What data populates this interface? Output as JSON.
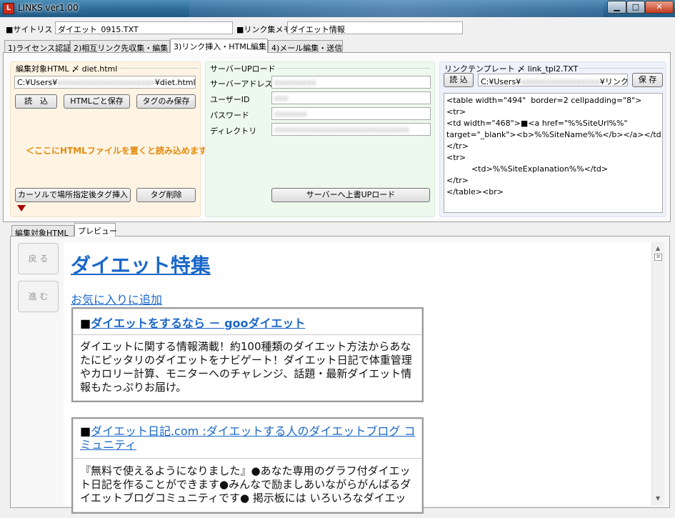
{
  "window": {
    "title": "LINKS ver1.00",
    "icon_letter": "L",
    "min_glyph": "▁",
    "max_glyph": "□",
    "close_glyph": "✕"
  },
  "top": {
    "site_list_label": "■サイトリスト",
    "site_list_value": "ダイエット_0915.TXT",
    "link_memo_label": "■リンク集メモ",
    "link_memo_value": "ダイエット情報"
  },
  "tabs": [
    {
      "label": "1)ライセンス認証"
    },
    {
      "label": "2)相互リンク先収集・編集"
    },
    {
      "label": "3)リンク挿入・HTML編集"
    },
    {
      "label": "4)メール編集・送信"
    }
  ],
  "html_panel": {
    "title": "編集対象HTML 〆 diet.html",
    "path": "C:¥Users¥",
    "path_end": "¥diet.html",
    "load_button": "読　込",
    "save_html_button": "HTMLごと保存",
    "save_tag_button": "タグのみ保存",
    "drop_hint": "＜ここにHTMLファイルを置くと読み込めます＞",
    "insert_tag_button": "カーソルで場所指定後タグ挿入",
    "delete_tag_button": "タグ削除"
  },
  "server_panel": {
    "title": "サーバーUPロード",
    "address_label": "サーバーアドレス",
    "user_label": "ユーザーID",
    "password_label": "パスワード",
    "directory_label": "ディレクトリ",
    "upload_button": "サーバーへ上書UPロード"
  },
  "template_panel": {
    "title": "リンクテンプレート 〆 link_tpl2.TXT",
    "load_button": "読 込",
    "path": "C:¥Users¥",
    "path_end": "¥リンク",
    "save_button": "保 存",
    "content": "<table width=\"494\"  border=2 cellpadding=\"8\">\n<tr>\n<td width=\"468\">■<a href=\"%%SiteUrl%%\"\ntarget=\"_blank\"><b>%%SiteName%%</b></a></td>\n</tr>\n<tr>\n          <td>%%SiteExplanation%%</td>\n</tr>\n</table><br>"
  },
  "lower_tabs": [
    {
      "label": "編集対象HTML"
    },
    {
      "label": "プレビュー"
    }
  ],
  "preview": {
    "back_button": "戻 る",
    "forward_button": "進 む",
    "page_title": "ダイエット特集",
    "favorite_link": "お気に入りに追加",
    "cards": [
      {
        "bullet": "■",
        "link": "ダイエットをするなら － gooダイエット",
        "text": "ダイエットに関する情報満載！約100種類のダイエット方法からあなたにピッタリのダイエットをナビゲート！ダイエット日記で体重管理やカロリー計算、モニターへのチャレンジ、話題・最新ダイエット情報もたっぷりお届け。"
      },
      {
        "bullet": "■",
        "link": "ダイエット日記.com :ダイエットする人のダイエットブログ コミュニティ",
        "text": "『無料で使えるようになりました』●あなた専用のグラフ付ダイエット日記を作ることができます●みんなで励ましあいながらがんばるダイエットブログコミュニティです● 掲示板には いろいろなダイエットの体験談"
      }
    ]
  }
}
